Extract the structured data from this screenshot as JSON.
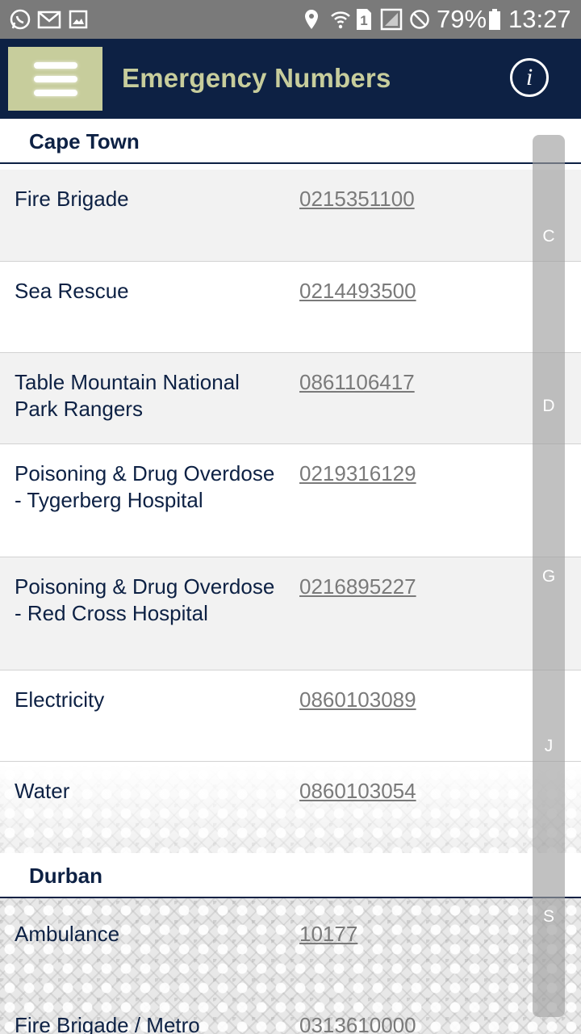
{
  "status_bar": {
    "icons": [
      "whatsapp-icon",
      "gmail-icon",
      "gallery-icon",
      "location-icon",
      "wifi-icon",
      "sim-1-icon",
      "signal-icon",
      "do-not-disturb-icon",
      "battery-icon"
    ],
    "sim_label": "1",
    "battery": "79%",
    "time": "13:27"
  },
  "app_bar": {
    "title": "Emergency Numbers",
    "info_glyph": "i",
    "colors": {
      "background": "#0d2144",
      "accent": "#c7cd9c"
    }
  },
  "sections": [
    {
      "title": "Cape Town",
      "entries": [
        {
          "name": "Fire Brigade",
          "phone": "0215351100"
        },
        {
          "name": "Sea Rescue",
          "phone": "0214493500"
        },
        {
          "name": "Table Mountain National Park Rangers",
          "phone": "0861106417"
        },
        {
          "name": "Poisoning & Drug Overdose - Tygerberg Hospital",
          "phone": "0219316129"
        },
        {
          "name": "Poisoning & Drug Overdose - Red Cross Hospital",
          "phone": "0216895227"
        },
        {
          "name": "Electricity",
          "phone": "0860103089"
        },
        {
          "name": "Water",
          "phone": "0860103054"
        }
      ]
    },
    {
      "title": "Durban",
      "entries": [
        {
          "name": "Ambulance",
          "phone": "10177"
        },
        {
          "name": "Fire Brigade / Metro",
          "phone": "0313610000"
        }
      ]
    }
  ],
  "index_letters": [
    "C",
    "D",
    "G",
    "J",
    "S"
  ]
}
